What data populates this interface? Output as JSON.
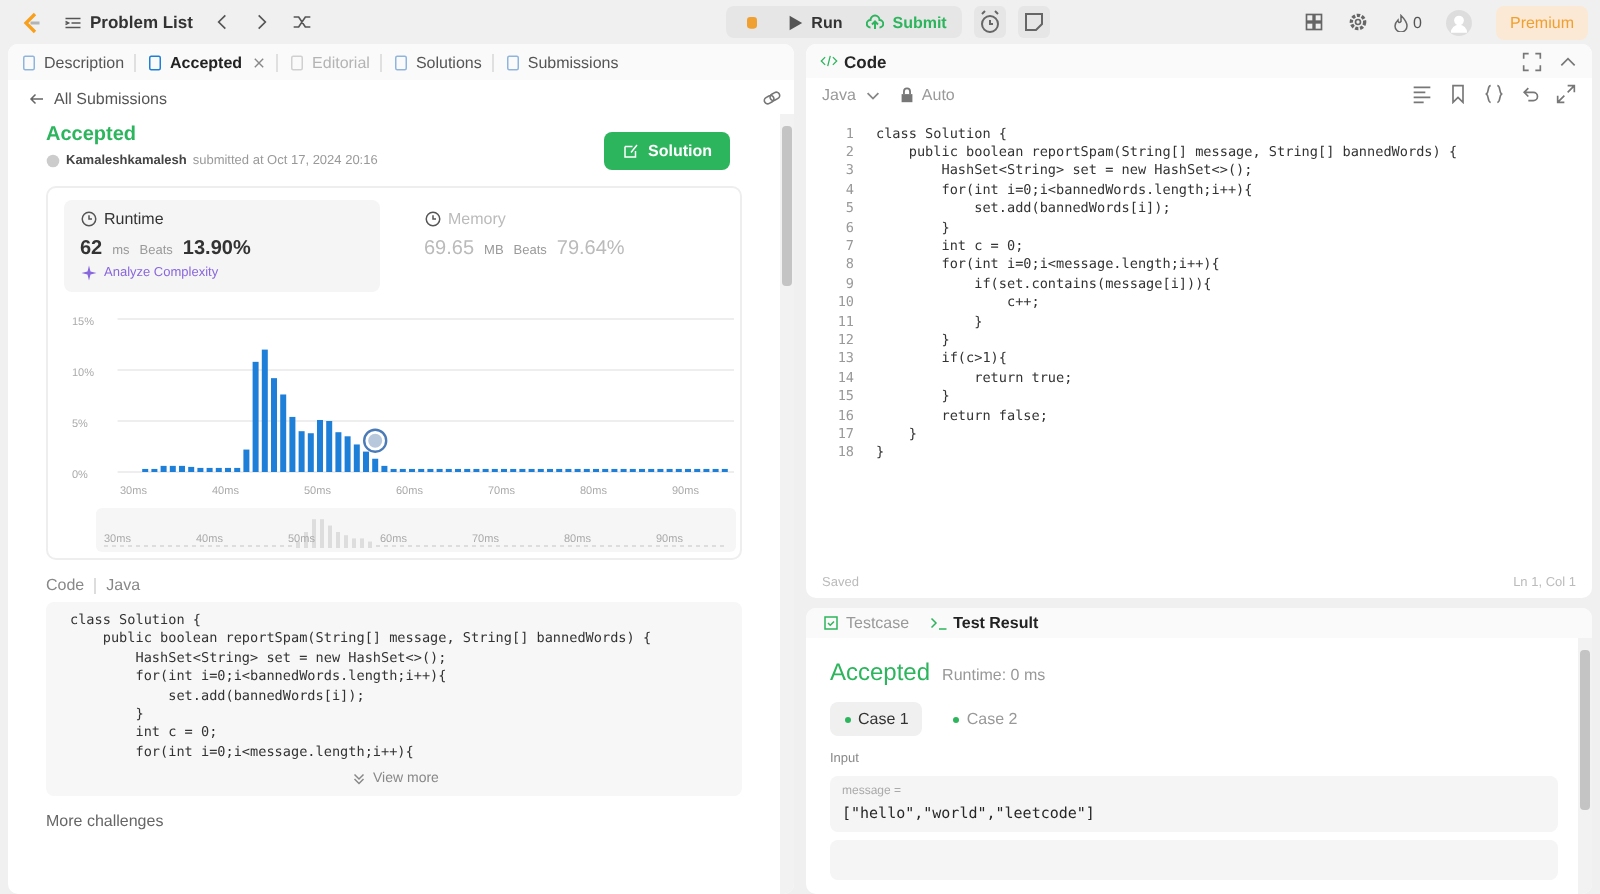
{
  "top_bar": {
    "problem_list": "Problem List",
    "run": "Run",
    "submit": "Submit",
    "streak": "0",
    "premium": "Premium"
  },
  "left_tabs": [
    {
      "label": "Description",
      "selected": false,
      "disabled": false
    },
    {
      "label": "Accepted",
      "selected": true,
      "disabled": false
    },
    {
      "label": "Editorial",
      "selected": false,
      "disabled": true
    },
    {
      "label": "Solutions",
      "selected": false,
      "disabled": false
    },
    {
      "label": "Submissions",
      "selected": false,
      "disabled": false
    }
  ],
  "back_link": "All Submissions",
  "submission": {
    "status": "Accepted",
    "user": "Kamaleshkamalesh",
    "submitted": "submitted at Oct 17, 2024 20:16",
    "solution_button": "Solution"
  },
  "stats": [
    {
      "label": "Runtime",
      "value": "62",
      "unit": "ms",
      "beats_label": "Beats",
      "beats": "13.90%",
      "selected": true,
      "analyze": "Analyze Complexity"
    },
    {
      "label": "Memory",
      "value": "69.65",
      "unit": "MB",
      "beats_label": "Beats",
      "beats": "79.64%",
      "selected": false
    }
  ],
  "chart_data": {
    "type": "bar",
    "x": [
      31,
      32,
      33,
      34,
      35,
      36,
      37,
      38,
      39,
      40,
      41,
      42,
      43,
      44,
      45,
      46,
      47,
      48,
      49,
      50,
      51,
      52,
      53,
      54,
      55,
      56,
      57,
      58,
      59,
      60,
      61,
      62,
      63,
      64,
      65,
      66,
      67,
      68,
      69,
      70,
      71,
      72,
      73,
      74,
      75,
      76,
      77,
      78,
      79,
      80,
      81,
      82,
      83,
      84,
      85,
      86,
      87,
      88,
      89,
      90,
      91,
      92,
      93,
      94
    ],
    "values": [
      0.3,
      0.3,
      0.6,
      0.6,
      0.6,
      0.5,
      0.4,
      0.4,
      0.4,
      0.4,
      0.4,
      2.2,
      10.8,
      12,
      9.2,
      7.6,
      5.4,
      4,
      3.8,
      5.1,
      5,
      3.9,
      3.5,
      2.7,
      2,
      1.3,
      0.6,
      0.3,
      0.3,
      0.3,
      0.3,
      0.3,
      0.3,
      0.3,
      0.3,
      0.3,
      0.3,
      0.3,
      0.3,
      0.3,
      0.3,
      0.3,
      0.3,
      0.3,
      0.3,
      0.3,
      0.3,
      0.3,
      0.3,
      0.3,
      0.3,
      0.3,
      0.3,
      0.3,
      0.3,
      0.3,
      0.3,
      0.3,
      0.3,
      0.3,
      0.3,
      0.3,
      0.3,
      0.3
    ],
    "xlim": [
      28,
      95
    ],
    "ylim": [
      0,
      15
    ],
    "xticks": [
      {
        "value": 30,
        "label": "30ms"
      },
      {
        "value": 40,
        "label": "40ms"
      },
      {
        "value": 50,
        "label": "50ms"
      },
      {
        "value": 60,
        "label": "60ms"
      },
      {
        "value": 70,
        "label": "70ms"
      },
      {
        "value": 80,
        "label": "80ms"
      },
      {
        "value": 90,
        "label": "90ms"
      }
    ],
    "yticks": [
      {
        "value": 0,
        "label": "0%"
      },
      {
        "value": 5,
        "label": "5%"
      },
      {
        "value": 10,
        "label": "10%"
      },
      {
        "value": 15,
        "label": "15%"
      }
    ]
  },
  "overview_labels": [
    "30ms",
    "40ms",
    "50ms",
    "60ms",
    "70ms",
    "80ms",
    "90ms"
  ],
  "code_section": {
    "label": "Code",
    "language": "Java",
    "view_more": "View more",
    "lines": [
      "class Solution {",
      "    public boolean reportSpam(String[] message, String[] bannedWords) {",
      "        HashSet<String> set = new HashSet<>();",
      "        for(int i=0;i<bannedWords.length;i++){",
      "            set.add(bannedWords[i]);",
      "        }",
      "        int c = 0;",
      "        for(int i=0;i<message.length;i++){"
    ]
  },
  "more_challenges": "More challenges",
  "editor": {
    "title": "Code",
    "language": "Java",
    "mode": "Auto",
    "status": "Saved",
    "position": "Ln 1, Col 1",
    "lines": [
      {
        "number": "1",
        "text": "class Solution {"
      },
      {
        "number": "2",
        "text": "    public boolean reportSpam(String[] message, String[] bannedWords) {"
      },
      {
        "number": "3",
        "text": "        HashSet<String> set = new HashSet<>();"
      },
      {
        "number": "4",
        "text": "        for(int i=0;i<bannedWords.length;i++){"
      },
      {
        "number": "5",
        "text": "            set.add(bannedWords[i]);"
      },
      {
        "number": "6",
        "text": "        }"
      },
      {
        "number": "7",
        "text": "        int c = 0;"
      },
      {
        "number": "8",
        "text": "        for(int i=0;i<message.length;i++){"
      },
      {
        "number": "9",
        "text": "            if(set.contains(message[i])){"
      },
      {
        "number": "10",
        "text": "                c++;"
      },
      {
        "number": "11",
        "text": "            }"
      },
      {
        "number": "12",
        "text": "        }"
      },
      {
        "number": "13",
        "text": "        if(c>1){"
      },
      {
        "number": "14",
        "text": "            return true;"
      },
      {
        "number": "15",
        "text": "        }"
      },
      {
        "number": "16",
        "text": "        return false;"
      },
      {
        "number": "17",
        "text": "    }"
      },
      {
        "number": "18",
        "text": "}"
      }
    ]
  },
  "test_tabs": [
    {
      "label": "Testcase",
      "selected": false
    },
    {
      "label": "Test Result",
      "selected": true
    }
  ],
  "test_result": {
    "status": "Accepted",
    "runtime": "Runtime: 0 ms",
    "input_label": "Input",
    "cases": [
      {
        "label": "Case 1",
        "selected": true
      },
      {
        "label": "Case 2",
        "selected": false
      }
    ],
    "inputs": [
      {
        "name": "message =",
        "value": "[\"hello\",\"world\",\"leetcode\"]"
      }
    ]
  }
}
